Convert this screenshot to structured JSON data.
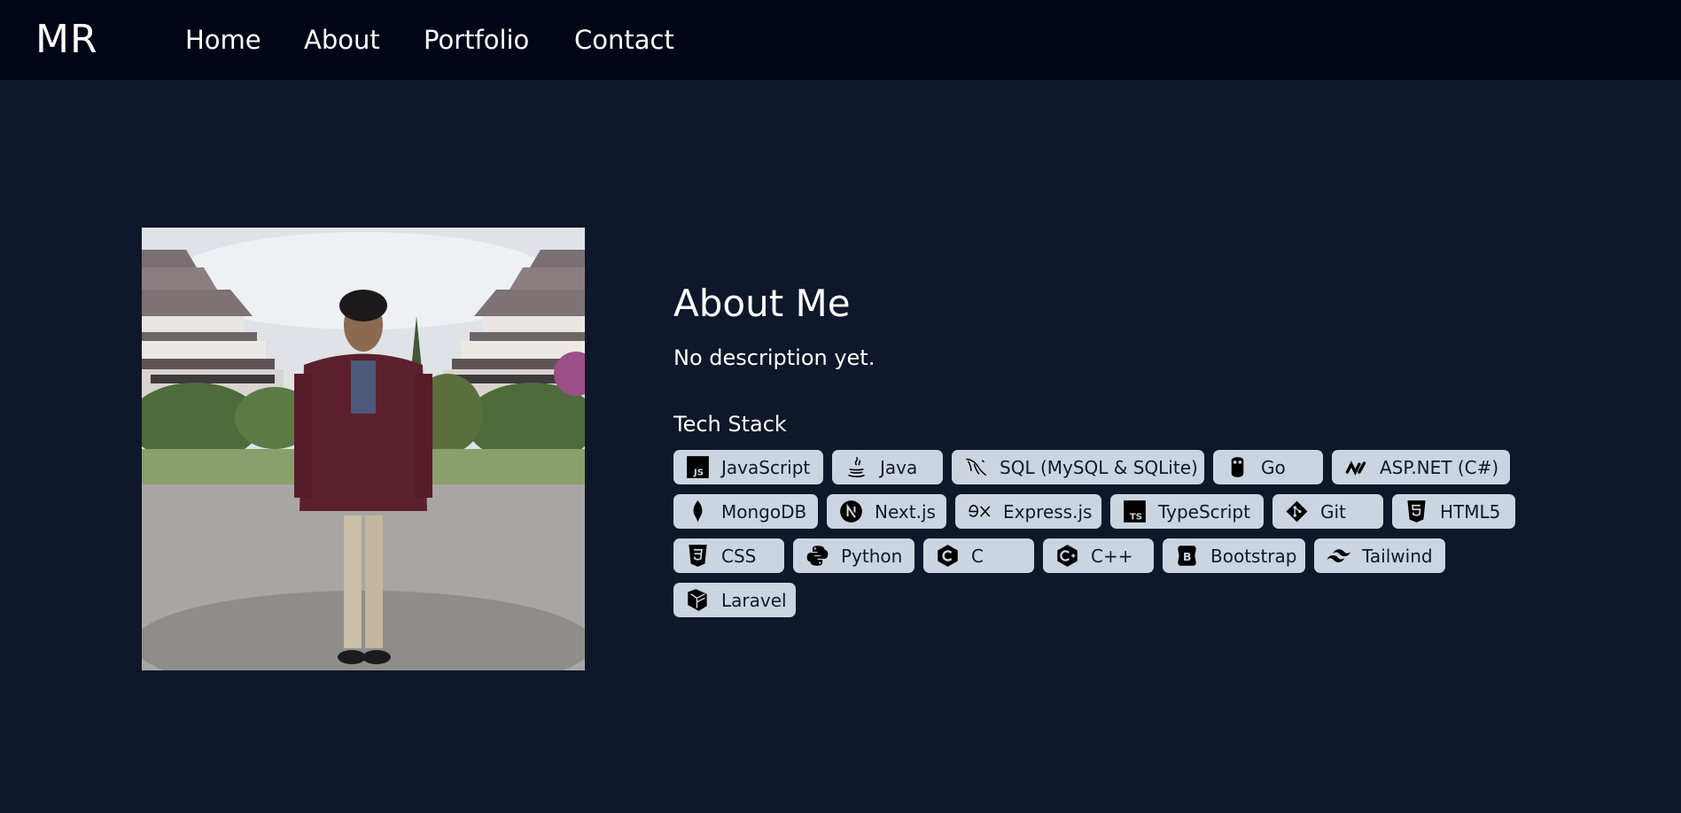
{
  "header": {
    "logo": "MR",
    "nav": [
      {
        "label": "Home"
      },
      {
        "label": "About"
      },
      {
        "label": "Portfolio"
      },
      {
        "label": "Contact"
      }
    ]
  },
  "about": {
    "title": "About Me",
    "description": "No description yet.",
    "stack_title": "Tech Stack",
    "stack": [
      {
        "label": "JavaScript",
        "icon": "javascript-icon"
      },
      {
        "label": "Java",
        "icon": "java-icon"
      },
      {
        "label": "SQL (MySQL & SQLite)",
        "icon": "mysql-icon"
      },
      {
        "label": "Go",
        "icon": "go-gopher-icon"
      },
      {
        "label": "ASP.NET (C#)",
        "icon": "dotnet-icon"
      },
      {
        "label": "MongoDB",
        "icon": "mongodb-icon"
      },
      {
        "label": "Next.js",
        "icon": "nextjs-icon"
      },
      {
        "label": "Express.js",
        "icon": "express-icon"
      },
      {
        "label": "TypeScript",
        "icon": "typescript-icon"
      },
      {
        "label": "Git",
        "icon": "git-icon"
      },
      {
        "label": "HTML5",
        "icon": "html5-icon"
      },
      {
        "label": "CSS",
        "icon": "css3-icon"
      },
      {
        "label": "Python",
        "icon": "python-icon"
      },
      {
        "label": "C",
        "icon": "c-icon"
      },
      {
        "label": "C++",
        "icon": "cplusplus-icon"
      },
      {
        "label": "Bootstrap",
        "icon": "bootstrap-icon"
      },
      {
        "label": "Tailwind",
        "icon": "tailwind-icon"
      },
      {
        "label": "Laravel",
        "icon": "laravel-icon"
      }
    ]
  },
  "colors": {
    "page_bg": "#0f172a",
    "navbar_bg": "#020617",
    "chip_bg": "#cbd5e1",
    "text": "#ffffff"
  }
}
